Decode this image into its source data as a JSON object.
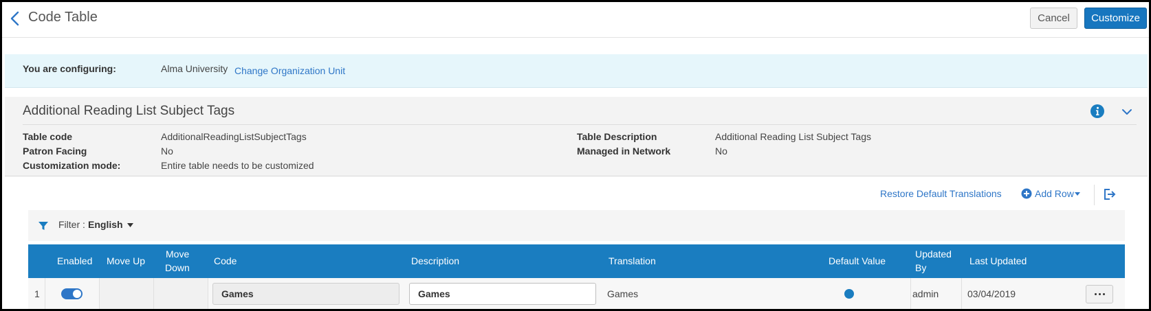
{
  "header": {
    "title": "Code Table",
    "cancel_label": "Cancel",
    "customize_label": "Customize"
  },
  "config": {
    "label": "You are configuring:",
    "org": "Alma University",
    "change_link": "Change Organization Unit"
  },
  "details": {
    "title": "Additional Reading List Subject Tags",
    "table_code_label": "Table code",
    "table_code_value": "AdditionalReadingListSubjectTags",
    "patron_facing_label": "Patron Facing",
    "patron_facing_value": "No",
    "customization_mode_label": "Customization mode:",
    "customization_mode_value": "Entire table needs to be customized",
    "table_description_label": "Table Description",
    "table_description_value": "Additional Reading List Subject Tags",
    "managed_in_network_label": "Managed in Network",
    "managed_in_network_value": "No"
  },
  "toolbar": {
    "restore_label": "Restore Default Translations",
    "add_row_label": "Add Row"
  },
  "filter": {
    "label": "Filter :",
    "value": "English"
  },
  "table": {
    "headers": {
      "enabled": "Enabled",
      "move_up": "Move Up",
      "move_down_1": "Move",
      "move_down_2": "Down",
      "code": "Code",
      "description": "Description",
      "translation": "Translation",
      "default_value": "Default Value",
      "updated_by_1": "Updated",
      "updated_by_2": "By",
      "last_updated": "Last Updated"
    },
    "rows": [
      {
        "num": "1",
        "enabled": true,
        "code": "Games",
        "description": "Games",
        "translation": "Games",
        "default": true,
        "updated_by": "admin",
        "last_updated": "03/04/2019"
      }
    ]
  },
  "colors": {
    "accent": "#1776bf",
    "header_bg": "#1a7dc0",
    "config_bg": "#e6f6fb",
    "link": "#2e76c7"
  }
}
